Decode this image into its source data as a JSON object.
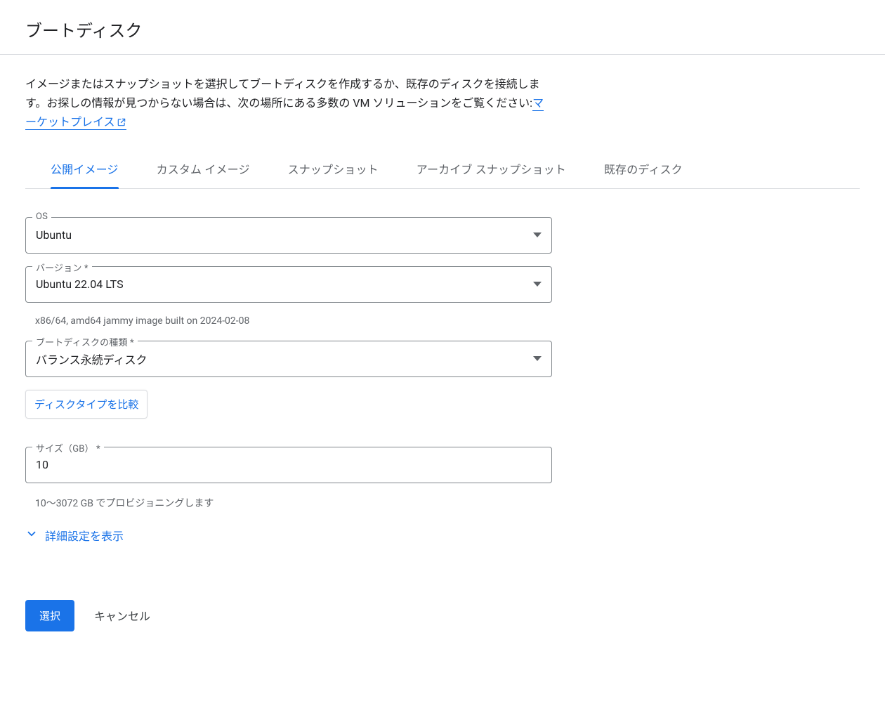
{
  "header": {
    "title": "ブートディスク"
  },
  "intro": {
    "text_before_link": "イメージまたはスナップショットを選択してブートディスクを作成するか、既存のディスクを接続します。お探しの情報が見つからない場合は、次の場所にある多数の VM ソリューションをご覧ください:",
    "link_text": "マーケットプレイス"
  },
  "tabs": {
    "public_images": "公開イメージ",
    "custom_images": "カスタム イメージ",
    "snapshots": "スナップショット",
    "archive_snapshots": "アーカイブ スナップショット",
    "existing_disks": "既存のディスク"
  },
  "form": {
    "os": {
      "label": "OS",
      "value": "Ubuntu"
    },
    "version": {
      "label": "バージョン *",
      "value": "Ubuntu 22.04 LTS",
      "helper": "x86/64, amd64 jammy image built on 2024-02-08"
    },
    "disk_type": {
      "label": "ブートディスクの種類 *",
      "value": "バランス永続ディスク"
    },
    "compare_label": "ディスクタイプを比較",
    "size": {
      "label": "サイズ（GB） *",
      "value": "10",
      "helper": "10～3072 GB でプロビジョニングします"
    },
    "advanced_toggle": "詳細設定を表示"
  },
  "footer": {
    "select": "選択",
    "cancel": "キャンセル"
  }
}
